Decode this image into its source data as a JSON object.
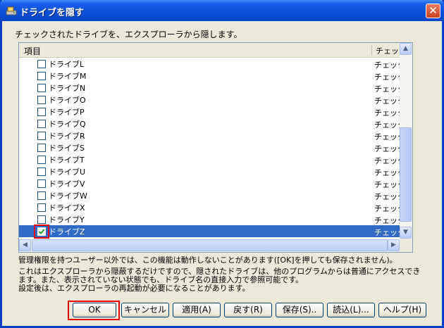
{
  "window": {
    "title": "ドライブを隠す",
    "close_glyph": "✕"
  },
  "description": "チェックされたドライブを、エクスプローラから隠します。",
  "list": {
    "columns": [
      "項目",
      "チェック"
    ],
    "rows": [
      {
        "name": "ドライブL",
        "checked": false,
        "state": "チェック"
      },
      {
        "name": "ドライブM",
        "checked": false,
        "state": "チェック"
      },
      {
        "name": "ドライブN",
        "checked": false,
        "state": "チェック"
      },
      {
        "name": "ドライブO",
        "checked": false,
        "state": "チェック"
      },
      {
        "name": "ドライブP",
        "checked": false,
        "state": "チェック"
      },
      {
        "name": "ドライブQ",
        "checked": false,
        "state": "チェック"
      },
      {
        "name": "ドライブR",
        "checked": false,
        "state": "チェック"
      },
      {
        "name": "ドライブS",
        "checked": false,
        "state": "チェック"
      },
      {
        "name": "ドライブT",
        "checked": false,
        "state": "チェック"
      },
      {
        "name": "ドライブU",
        "checked": false,
        "state": "チェック"
      },
      {
        "name": "ドライブV",
        "checked": false,
        "state": "チェック"
      },
      {
        "name": "ドライブW",
        "checked": false,
        "state": "チェック"
      },
      {
        "name": "ドライブX",
        "checked": false,
        "state": "チェック"
      },
      {
        "name": "ドライブY",
        "checked": false,
        "state": "チェック"
      },
      {
        "name": "ドライブZ",
        "checked": true,
        "state": "チェック",
        "selected": true
      }
    ]
  },
  "notes": [
    "管理権限を持つユーザー以外では、この機能は動作しないことがあります([OK]を押しても保存されません)。",
    "これはエクスプローラから隠蔽するだけですので、隠されたドライブは、他のプログラムからは普通にアクセスできます。また、表示されていない状態でも、ドライブ名の直接入力で参照可能です。",
    "設定後は、エクスプローラの再起動が必要になることがあります。"
  ],
  "buttons": {
    "ok": "OK",
    "cancel": "キャンセル",
    "apply": "適用(A)",
    "back": "戻す(R)",
    "save": "保存(S)..",
    "load": "読込(L)...",
    "help": "ヘルプ(H)"
  },
  "colors": {
    "highlight": "#e60000",
    "selection": "#316ac5",
    "titlebar": "#0a4fd8"
  }
}
